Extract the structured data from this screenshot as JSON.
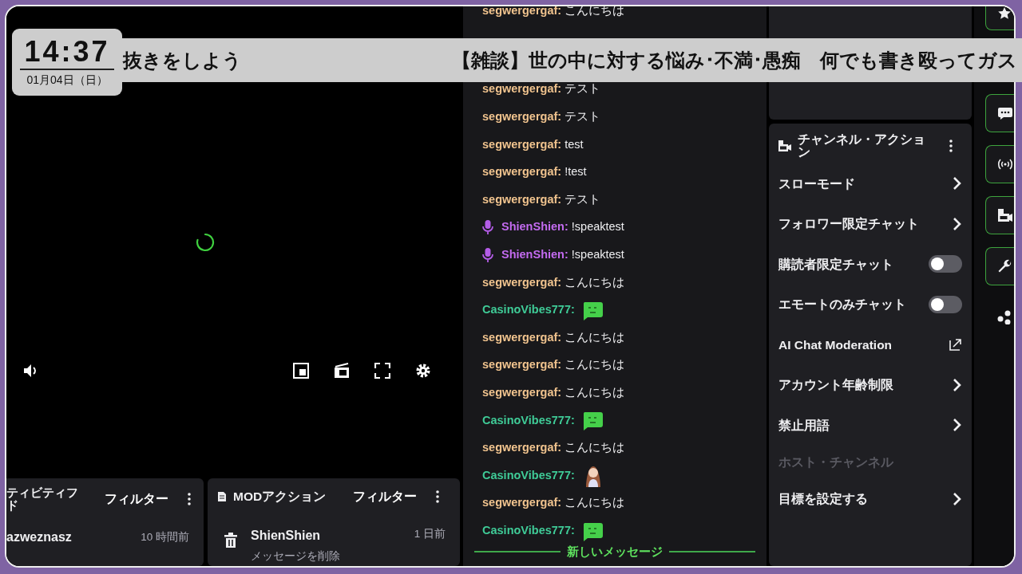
{
  "banner": {
    "left_text": "抜きをしよう",
    "right_text": "【雑談】世の中に対する悩み･不満･愚痴　何でも書き殴ってガス"
  },
  "clock": {
    "time": "14:37",
    "date": "01月04日（日）"
  },
  "activity_feed": {
    "title_lines": [
      "ティビティフ",
      "ド"
    ],
    "filter": "フィルター",
    "items": [
      {
        "user": "azweznasz",
        "time": "10 時間前"
      }
    ]
  },
  "mod_actions": {
    "title": "MODアクション",
    "filter": "フィルター",
    "items": [
      {
        "user": "ShienShien",
        "time": "1 日前",
        "action": "メッセージを削除"
      }
    ]
  },
  "chat": {
    "messages": [
      {
        "user": "segwergergaf:",
        "color": "#f0c38e",
        "kind": "text",
        "text": "こんにちは"
      },
      {
        "user": "segwergergaf:",
        "color": "#f0c38e",
        "kind": "text",
        "text": "テスト"
      },
      {
        "user": "segwergergaf:",
        "color": "#f0c38e",
        "kind": "text",
        "text": "テスト"
      },
      {
        "user": "segwergergaf:",
        "color": "#f0c38e",
        "kind": "text",
        "text": "test"
      },
      {
        "user": "segwergergaf:",
        "color": "#f0c38e",
        "kind": "text",
        "text": "!test"
      },
      {
        "user": "segwergergaf:",
        "color": "#f0c38e",
        "kind": "text",
        "text": "テスト"
      },
      {
        "user": "ShienShien:",
        "color": "#c36bf0",
        "kind": "voice",
        "text": "!speaktest"
      },
      {
        "user": "ShienShien:",
        "color": "#c36bf0",
        "kind": "voice",
        "text": "!speaktest"
      },
      {
        "user": "segwergergaf:",
        "color": "#f0c38e",
        "kind": "text",
        "text": "こんにちは"
      },
      {
        "user": "CasinoVibes777:",
        "color": "#3fcb97",
        "kind": "emote"
      },
      {
        "user": "segwergergaf:",
        "color": "#f0c38e",
        "kind": "text",
        "text": "こんにちは"
      },
      {
        "user": "segwergergaf:",
        "color": "#f0c38e",
        "kind": "text",
        "text": "こんにちは"
      },
      {
        "user": "segwergergaf:",
        "color": "#f0c38e",
        "kind": "text",
        "text": "こんにちは"
      },
      {
        "user": "CasinoVibes777:",
        "color": "#3fcb97",
        "kind": "emote"
      },
      {
        "user": "segwergergaf:",
        "color": "#f0c38e",
        "kind": "text",
        "text": "こんにちは"
      },
      {
        "user": "CasinoVibes777:",
        "color": "#3fcb97",
        "kind": "sticker"
      },
      {
        "user": "segwergergaf:",
        "color": "#f0c38e",
        "kind": "text",
        "text": "こんにちは"
      },
      {
        "user": "CasinoVibes777:",
        "color": "#3fcb97",
        "kind": "emote"
      }
    ],
    "new_messages": "新しいメッセージ"
  },
  "channel_actions": {
    "title": "チャンネル・アクション",
    "items": [
      {
        "label": "スローモード",
        "kind": "arrow"
      },
      {
        "label": "フォロワー限定チャット",
        "kind": "arrow"
      },
      {
        "label": "購読者限定チャット",
        "kind": "toggle",
        "on": false
      },
      {
        "label": "エモートのみチャット",
        "kind": "toggle",
        "on": false
      },
      {
        "label": "AI Chat Moderation",
        "kind": "external"
      },
      {
        "label": "アカウント年齢制限",
        "kind": "arrow"
      },
      {
        "label": "禁止用語",
        "kind": "arrow"
      },
      {
        "label": "ホスト・チャンネル",
        "kind": "plain",
        "disabled": true
      },
      {
        "label": "目標を設定する",
        "kind": "arrow"
      }
    ]
  }
}
